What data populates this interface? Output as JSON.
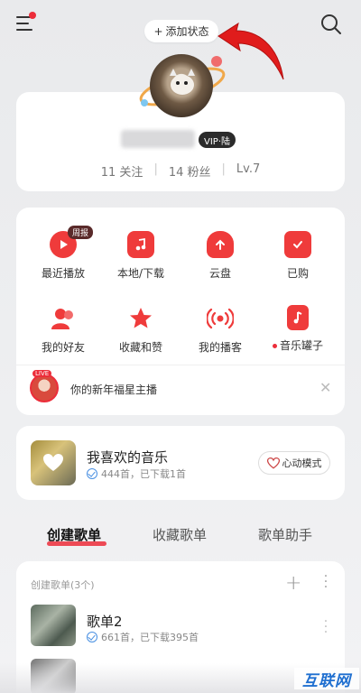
{
  "topbar": {
    "status_label": "添加状态",
    "plus": "+"
  },
  "profile": {
    "vip_label": "VIP·陆",
    "follow": "11 关注",
    "fans": "14 粉丝",
    "level": "Lv.7"
  },
  "features": [
    {
      "label": "最近播放",
      "icon": "play-icon",
      "tag": "周报"
    },
    {
      "label": "本地/下载",
      "icon": "music-folder-icon"
    },
    {
      "label": "云盘",
      "icon": "cloud-upload-icon"
    },
    {
      "label": "已购",
      "icon": "shopping-bag-icon"
    },
    {
      "label": "我的好友",
      "icon": "friends-icon"
    },
    {
      "label": "收藏和赞",
      "icon": "star-icon"
    },
    {
      "label": "我的播客",
      "icon": "podcast-icon"
    },
    {
      "label": "音乐罐子",
      "icon": "music-jar-icon",
      "dot": true
    }
  ],
  "promo": {
    "text": "你的新年福星主播",
    "live": "LIVE",
    "close": "✕"
  },
  "liked": {
    "title": "我喜欢的音乐",
    "sub": "444首，已下载1首",
    "mode_label": "心动模式"
  },
  "tabs": [
    "创建歌单",
    "收藏歌单",
    "歌单助手"
  ],
  "playlists": {
    "header": "创建歌单(3个)",
    "items": [
      {
        "title": "歌单2",
        "sub": "661首，已下载395首"
      }
    ]
  },
  "watermark": "互联网",
  "colors": {
    "accent": "#ec2d3a",
    "check": "#4a90e2"
  }
}
